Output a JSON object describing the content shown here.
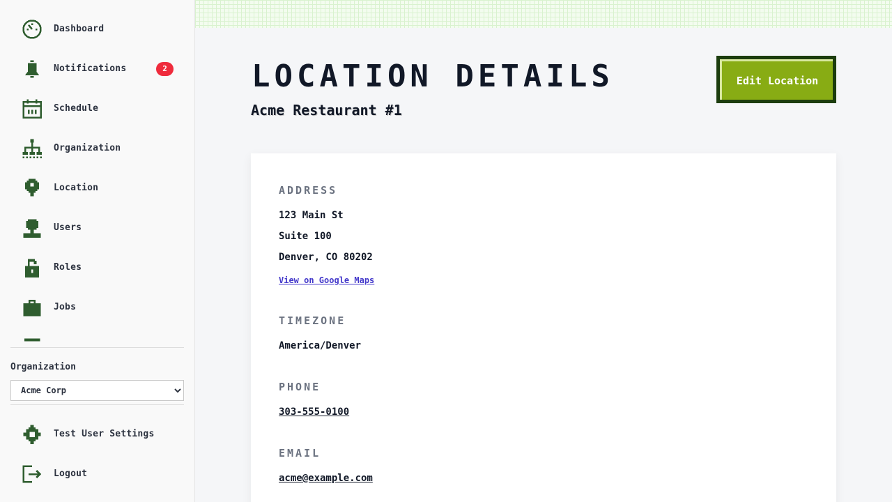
{
  "sidebar": {
    "items": [
      {
        "label": "Dashboard",
        "icon": "dashboard-icon"
      },
      {
        "label": "Notifications",
        "icon": "bell-icon",
        "badge": "2"
      },
      {
        "label": "Schedule",
        "icon": "calendar-icon"
      },
      {
        "label": "Organization",
        "icon": "org-chart-icon"
      },
      {
        "label": "Location",
        "icon": "map-pin-icon"
      },
      {
        "label": "Users",
        "icon": "user-icon"
      },
      {
        "label": "Roles",
        "icon": "unlock-icon"
      },
      {
        "label": "Jobs",
        "icon": "briefcase-icon"
      }
    ],
    "org_label": "Organization",
    "org_selected": "Acme Corp",
    "bottom": [
      {
        "label": "Test User Settings",
        "icon": "gear-icon"
      },
      {
        "label": "Logout",
        "icon": "logout-icon"
      }
    ]
  },
  "main": {
    "title": "Location Details",
    "subtitle": "Acme Restaurant #1",
    "edit_button": "Edit Location",
    "address_title": "Address",
    "address_line1": "123 Main St",
    "address_line2": "Suite 100",
    "address_line3": "Denver, CO 80202",
    "maps_link": "View on Google Maps",
    "timezone_title": "Timezone",
    "timezone": "America/Denver",
    "phone_title": "Phone",
    "phone": "303-555-0100",
    "email_title": "Email",
    "email": "acme@example.com"
  },
  "colors": {
    "accent_green": "#88ac14",
    "dark_green": "#1c3d0e",
    "icon_green": "#2f5d2f",
    "badge_red": "#ef2b3c",
    "link_blue": "#4338ca"
  }
}
